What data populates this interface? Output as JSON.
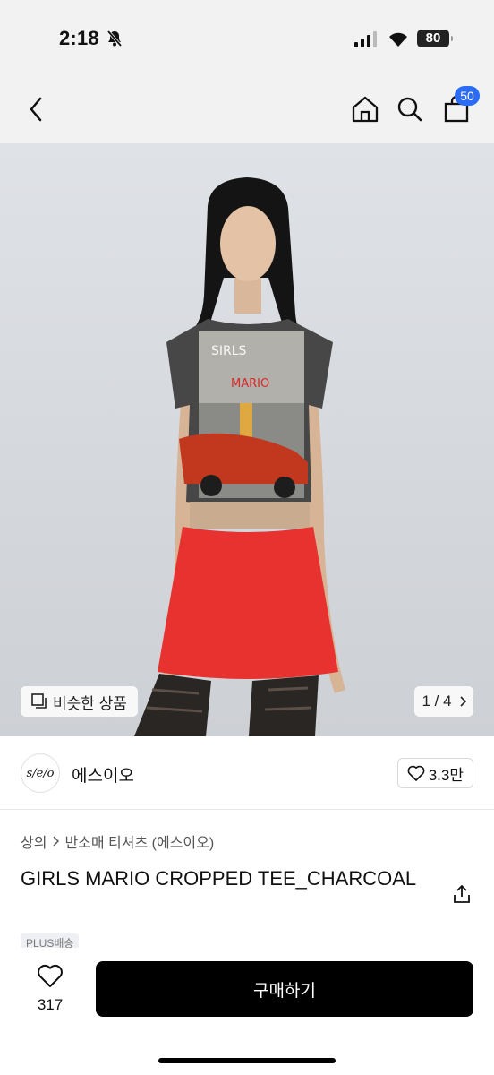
{
  "status_bar": {
    "time": "2:18",
    "battery": "80"
  },
  "nav": {
    "cart_count": "50"
  },
  "gallery": {
    "similar_label": "비슷한 상품",
    "counter": "1 / 4"
  },
  "brand": {
    "logo_text": "s/e/o",
    "name": "에스이오",
    "likes": "3.3만"
  },
  "product": {
    "breadcrumb": [
      "상의",
      "반소매 티셔츠 (에스이오)"
    ],
    "title": "GIRLS MARIO CROPPED TEE_CHARCOAL",
    "badge": "PLUS배송"
  },
  "bottom_bar": {
    "wish_count": "317",
    "buy_label": "구매하기"
  },
  "colors": {
    "accent_badge": "#2a6cf5",
    "buy_button": "#000000",
    "skirt": "#e8322f",
    "tee": "#4a4a4a"
  }
}
